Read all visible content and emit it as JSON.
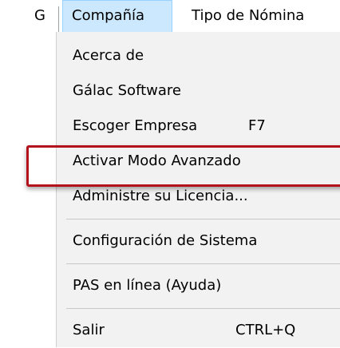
{
  "menubar": {
    "system_label": "G",
    "compania_label": "Compañía",
    "nomina_label": "Tipo de Nómina"
  },
  "menu": {
    "items": [
      {
        "label": "Acerca de",
        "shortcut": ""
      },
      {
        "label": "Gálac Software",
        "shortcut": ""
      },
      {
        "label": "Escoger Empresa",
        "shortcut": "F7"
      },
      {
        "label": "Activar Modo Avanzado",
        "shortcut": ""
      },
      {
        "label": "Administre su Licencia...",
        "shortcut": ""
      },
      {
        "label": "Configuración de Sistema",
        "shortcut": ""
      },
      {
        "label": "PAS en línea (Ayuda)",
        "shortcut": ""
      },
      {
        "label": "Salir",
        "shortcut": "CTRL+Q"
      }
    ]
  },
  "colors": {
    "menu_background": "#f2f2f2",
    "selected_menubar_background": "#cce8ff",
    "highlight_border": "#b3121c"
  }
}
